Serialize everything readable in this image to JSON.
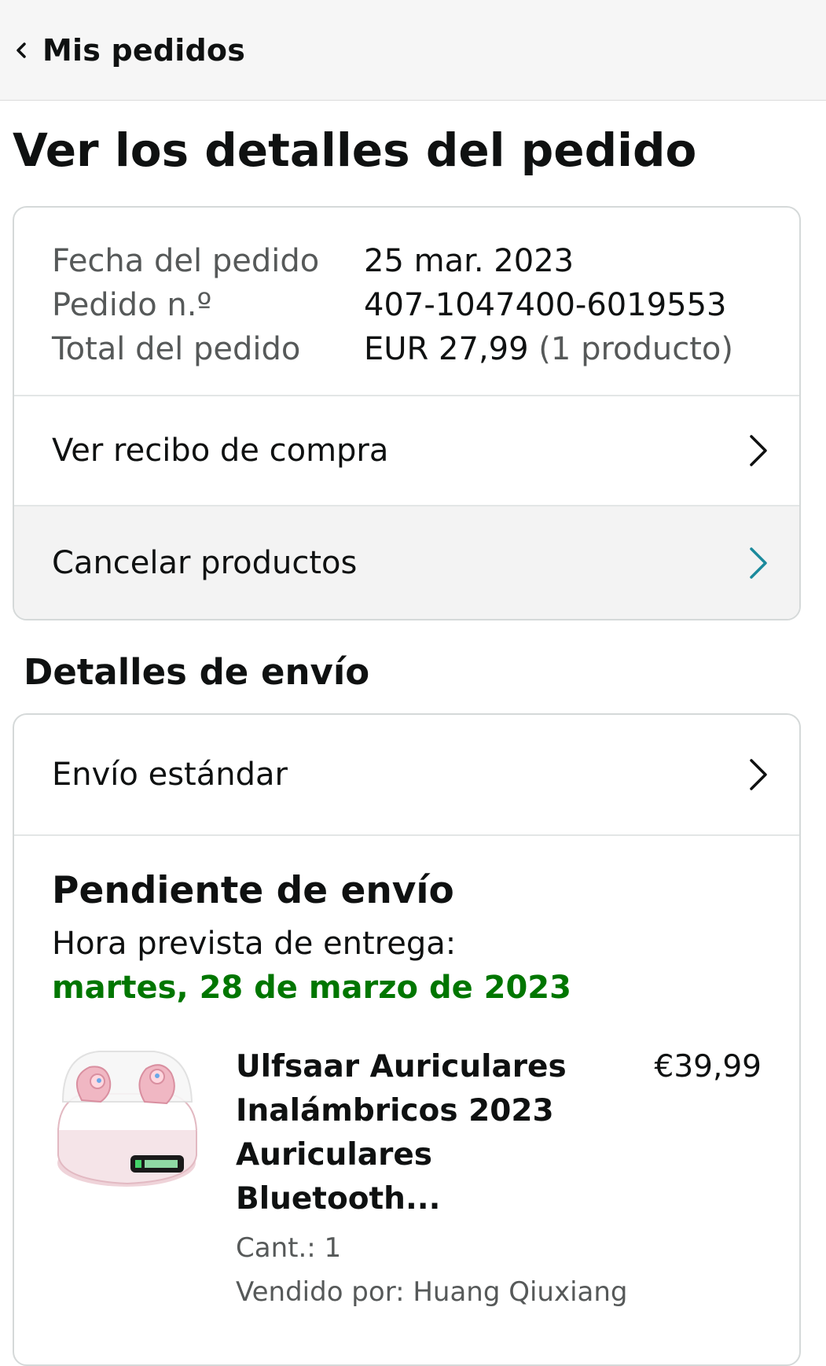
{
  "header": {
    "back_label": "Mis pedidos"
  },
  "page_title": "Ver los detalles del pedido",
  "order_summary": {
    "date_label": "Fecha del pedido",
    "date_value": "25 mar. 2023",
    "number_label": "Pedido n.º",
    "number_value": "407-1047400-6019553",
    "total_label": "Total del pedido",
    "total_value": "EUR 27,99",
    "total_count": "(1 producto)"
  },
  "actions": {
    "receipt": "Ver recibo de compra",
    "cancel": "Cancelar productos"
  },
  "shipping": {
    "section_title": "Detalles de envío",
    "method": "Envío estándar",
    "status": "Pendiente de envío",
    "eta_label": "Hora prevista de entrega:",
    "eta_date": "martes, 28 de marzo de 2023"
  },
  "product": {
    "title_lines": [
      "Ulfsaar Auriculares",
      "Inalámbricos 2023",
      "Auriculares",
      "Bluetooth..."
    ],
    "price": "€39,99",
    "quantity": "Cant.: 1",
    "seller": "Vendido por: Huang Qiuxiang"
  },
  "icons": {
    "back": "chevron-left-icon",
    "row_arrow": "chevron-right-icon"
  },
  "colors": {
    "delivery_green": "#007600",
    "cancel_arrow_teal": "#1b8a9c"
  }
}
